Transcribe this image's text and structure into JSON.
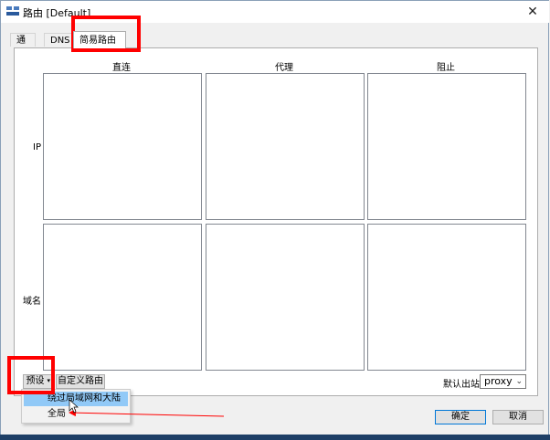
{
  "window": {
    "title": "路由 [Default]",
    "close_glyph": "✕"
  },
  "tabs": [
    {
      "label": "通用"
    },
    {
      "label": "DNS"
    },
    {
      "label": "简易路由",
      "active": true
    }
  ],
  "grid": {
    "columns": [
      "直连",
      "代理",
      "阻止"
    ],
    "rows": [
      "IP",
      "域名"
    ]
  },
  "bottom": {
    "preset_label": "预设",
    "preset_arrow": "▾",
    "custom_route_label": "自定义路由",
    "default_outbound_label": "默认出站",
    "default_outbound_value": "proxy",
    "combo_chevron": "⌄"
  },
  "preset_menu": {
    "items": [
      {
        "label": "绕过局域网和大陆",
        "highlighted": true
      },
      {
        "label": "全局"
      }
    ]
  },
  "footer": {
    "ok_label": "确定",
    "cancel_label": "取消"
  },
  "colors": {
    "annotation_red": "#ff0000",
    "menu_highlight": "#91c9f7",
    "primary_border": "#0078d7"
  }
}
